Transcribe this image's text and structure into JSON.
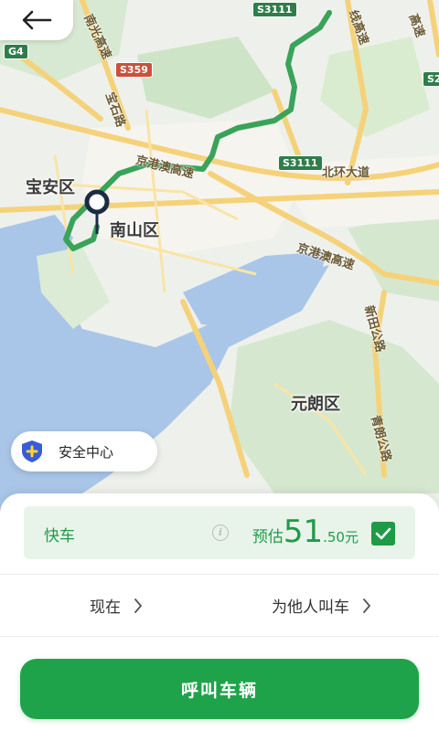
{
  "map": {
    "districts": [
      "宝安区",
      "南山区",
      "元朗区"
    ],
    "roads": [
      "京港澳高速",
      "北环大道",
      "京港澳高速",
      "新田公路",
      "青朗公路",
      "南光高速",
      "宝石路",
      "线高速",
      "高速"
    ],
    "shields": [
      "S3111",
      "S359",
      "S3111",
      "G4",
      "S2"
    ],
    "route_color": "#3aa35a"
  },
  "header": {
    "back_icon": "arrow-left-icon"
  },
  "safety_center": {
    "label": "安全中心",
    "icon": "shield-plus-icon"
  },
  "ride": {
    "name": "快车",
    "price_prefix": "预估",
    "price_main": "51",
    "price_decimal": ".50",
    "price_unit": "元",
    "selected": true
  },
  "options": {
    "time": "现在",
    "for_others": "为他人叫车"
  },
  "call_button": "呼叫车辆",
  "colors": {
    "accent": "#1fa34a",
    "card_bg": "#e8f4ea"
  }
}
